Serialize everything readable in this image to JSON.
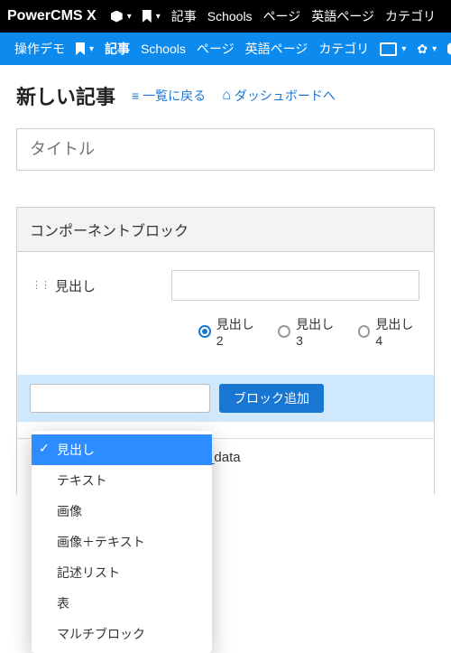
{
  "topbar": {
    "brand": "PowerCMS X",
    "items": [
      "記事",
      "Schools",
      "ページ",
      "英語ページ",
      "カテゴリ"
    ]
  },
  "bluebar": {
    "workspace": "操作デモ",
    "items": [
      "記事",
      "Schools",
      "ページ",
      "英語ページ",
      "カテゴリ"
    ]
  },
  "page": {
    "title": "新しい記事",
    "back_link": "一覧に戻る",
    "dashboard_link": "ダッシュボードへ",
    "title_placeholder": "タイトル"
  },
  "panel": {
    "heading": "コンポーネントブロック",
    "row_label": "見出し",
    "radios": [
      "見出し2",
      "見出し3",
      "見出し4"
    ],
    "selected_radio_index": 0,
    "add_button": "ブロック追加",
    "json_preview": "\"Heading\",\"text\":\"\",\"additional_data"
  },
  "dropdown": {
    "options": [
      "見出し",
      "テキスト",
      "画像",
      "画像＋テキスト",
      "記述リスト",
      "表",
      "マルチブロック"
    ],
    "selected_index": 0
  }
}
